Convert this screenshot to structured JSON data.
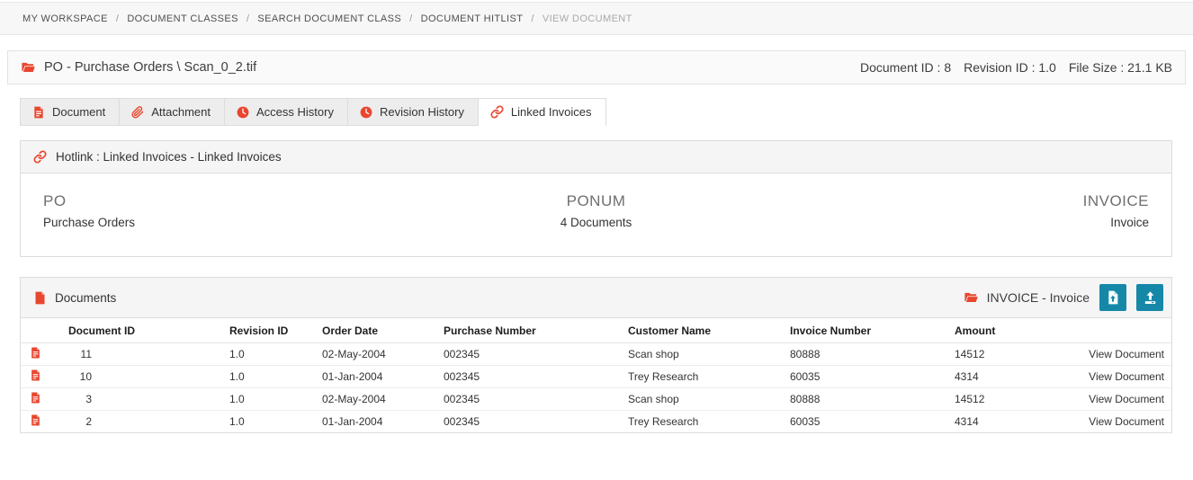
{
  "colors": {
    "accent_red": "#e9462f",
    "accent_teal": "#1588a8"
  },
  "breadcrumb": {
    "separator": "/",
    "items": [
      {
        "label": "MY WORKSPACE"
      },
      {
        "label": "DOCUMENT CLASSES"
      },
      {
        "label": "SEARCH DOCUMENT CLASS"
      },
      {
        "label": "DOCUMENT HITLIST"
      },
      {
        "label": "VIEW DOCUMENT"
      }
    ]
  },
  "header": {
    "title": "PO - Purchase Orders \\ Scan_0_2.tif",
    "icon": "folder-open-icon",
    "meta": [
      "Document ID : 8",
      "Revision ID : 1.0",
      "File Size : 21.1 KB"
    ]
  },
  "tabs": [
    {
      "label": "Document",
      "icon": "document-icon",
      "active": false
    },
    {
      "label": "Attachment",
      "icon": "paperclip-icon",
      "active": false
    },
    {
      "label": "Access History",
      "icon": "clock-icon",
      "active": false
    },
    {
      "label": "Revision History",
      "icon": "clock-icon",
      "active": false
    },
    {
      "label": "Linked Invoices",
      "icon": "link-icon",
      "active": true
    }
  ],
  "hotlink_panel": {
    "icon": "link-icon",
    "title": "Hotlink : Linked Invoices - Linked Invoices",
    "source": {
      "code": "PO",
      "description": "Purchase Orders"
    },
    "relation": {
      "code": "PONUM",
      "description": "4 Documents"
    },
    "target": {
      "code": "INVOICE",
      "description": "Invoice"
    }
  },
  "documents_panel": {
    "title": "Documents",
    "title_icon": "document-icon",
    "target_class": "INVOICE - Invoice",
    "target_icon": "folder-open-icon",
    "buttons": [
      {
        "name": "add-document",
        "icon": "file-upload-icon"
      },
      {
        "name": "upload-document",
        "icon": "upload-icon"
      }
    ],
    "table": {
      "columns": [
        "Document ID",
        "Revision ID",
        "Order Date",
        "Purchase Number",
        "Customer Name",
        "Invoice Number",
        "Amount"
      ],
      "rows": [
        {
          "document_id": "11",
          "revision_id": "1.0",
          "order_date": "02-May-2004",
          "purchase_number": "002345",
          "customer_name": "Scan shop",
          "invoice_number": "80888",
          "amount": "14512",
          "action": "View Document"
        },
        {
          "document_id": "10",
          "revision_id": "1.0",
          "order_date": "01-Jan-2004",
          "purchase_number": "002345",
          "customer_name": "Trey Research",
          "invoice_number": "60035",
          "amount": "4314",
          "action": "View Document"
        },
        {
          "document_id": "3",
          "revision_id": "1.0",
          "order_date": "02-May-2004",
          "purchase_number": "002345",
          "customer_name": "Scan shop",
          "invoice_number": "80888",
          "amount": "14512",
          "action": "View Document"
        },
        {
          "document_id": "2",
          "revision_id": "1.0",
          "order_date": "01-Jan-2004",
          "purchase_number": "002345",
          "customer_name": "Trey Research",
          "invoice_number": "60035",
          "amount": "4314",
          "action": "View Document"
        }
      ]
    }
  }
}
